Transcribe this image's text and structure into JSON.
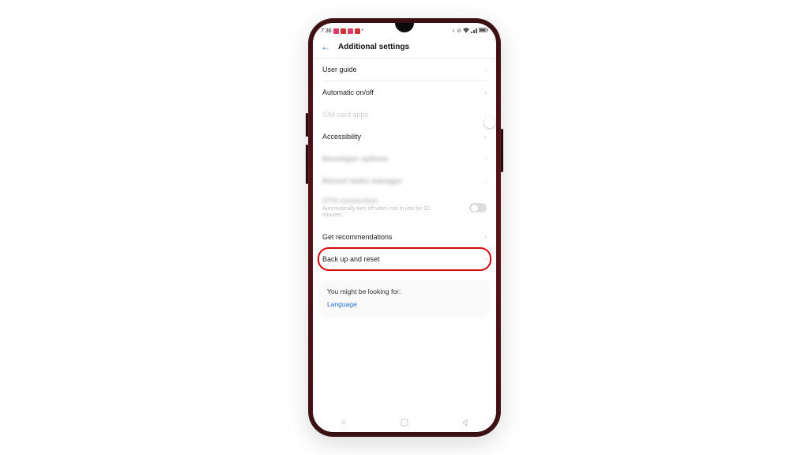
{
  "status": {
    "time": "7:36"
  },
  "header": {
    "title": "Additional settings"
  },
  "items": {
    "user_guide": "User guide",
    "auto_onoff": "Automatic on/off",
    "sim_apps": "SIM card apps",
    "accessibility": "Accessibility",
    "blurred1": "Developer options",
    "blurred2": "Recent tasks manager",
    "otg_title": "OTG connection",
    "otg_sub": "Automatically turn off when not in use for 10 minutes.",
    "get_rec": "Get recommendations",
    "backup": "Back up and reset"
  },
  "suggest": {
    "title": "You might be looking for:",
    "link": "Language"
  }
}
